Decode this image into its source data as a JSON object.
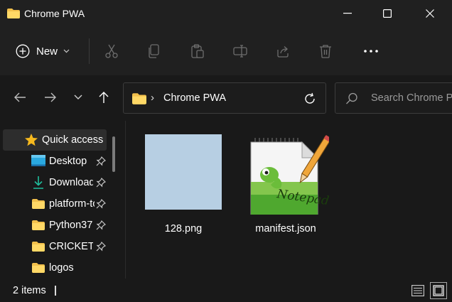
{
  "window": {
    "title": "Chrome PWA",
    "folder_color": "#F2C04C"
  },
  "toolbar": {
    "new_label": "New",
    "icons": [
      "cut-icon",
      "copy-icon",
      "paste-icon",
      "rename-icon",
      "share-icon",
      "delete-icon",
      "more-icon"
    ]
  },
  "address": {
    "path_segment": "Chrome PWA",
    "search_placeholder": "Search Chrome PWA"
  },
  "sidebar": {
    "items": [
      {
        "label": "Quick access",
        "icon": "star-icon",
        "pinned": false,
        "selected": true
      },
      {
        "label": "Desktop",
        "icon": "desktop-icon",
        "pinned": true
      },
      {
        "label": "Downloads",
        "icon": "download-icon",
        "pinned": true
      },
      {
        "label": "platform-tools",
        "icon": "folder-icon",
        "pinned": true
      },
      {
        "label": "Python37",
        "icon": "folder-icon",
        "pinned": true
      },
      {
        "label": "CRICKET GAME",
        "icon": "folder-icon",
        "pinned": true
      },
      {
        "label": "logos",
        "icon": "folder-icon",
        "pinned": false
      }
    ]
  },
  "files": [
    {
      "name": "128.png",
      "type": "image",
      "thumb_color": "#B7CFE3"
    },
    {
      "name": "manifest.json",
      "type": "json",
      "icon": "notepad-plus-plus-icon"
    }
  ],
  "status": {
    "item_count": "2 items"
  }
}
